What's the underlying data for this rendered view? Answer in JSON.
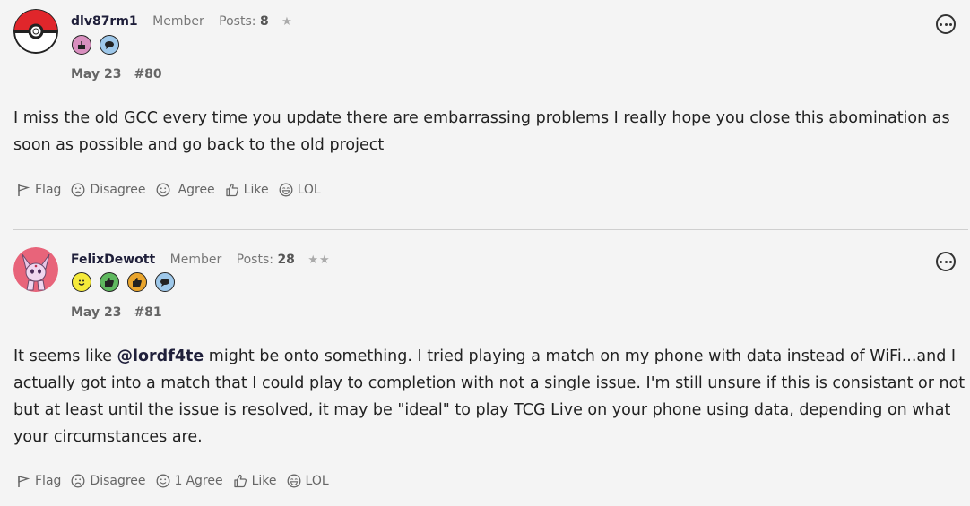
{
  "posts": [
    {
      "username": "dlv87rm1",
      "role": "Member",
      "posts_label": "Posts:",
      "posts_count": "8",
      "stars": "★",
      "badges": [
        "cake-badge-icon",
        "speech-bubble-badge-icon"
      ],
      "date": "May 23",
      "number": "#80",
      "body": "I miss the old GCC every time you update there are embarrassing problems I really hope you close this abomination as soon as possible and go back to the old project",
      "reactions": {
        "flag": "Flag",
        "disagree": "Disagree",
        "agree": "Agree",
        "agree_count": "",
        "like": "Like",
        "lol": "LOL"
      }
    },
    {
      "username": "FelixDewott",
      "role": "Member",
      "posts_label": "Posts:",
      "posts_count": "28",
      "stars": "★★",
      "badges": [
        "smiley-badge-icon",
        "thumbs-up-badge-icon",
        "like-badge-icon",
        "speech-bubble-badge-icon"
      ],
      "date": "May 23",
      "number": "#81",
      "body_before": "It seems like ",
      "mention": "@lordf4te",
      "body_after": " might be onto something. I tried playing a match on my phone with data instead of WiFi...and I actually got into a match that I could play to completion with not a single issue. I'm still unsure if this is consistant or not but at least until the issue is resolved, it may be \"ideal\" to play TCG Live on your phone using data, depending on what your circumstances are.",
      "reactions": {
        "flag": "Flag",
        "disagree": "Disagree",
        "agree": "Agree",
        "agree_count": "1",
        "like": "Like",
        "lol": "LOL"
      }
    }
  ],
  "colors": {
    "background": "#f4f4f4",
    "username": "#1f1f3a",
    "muted": "#777777"
  }
}
